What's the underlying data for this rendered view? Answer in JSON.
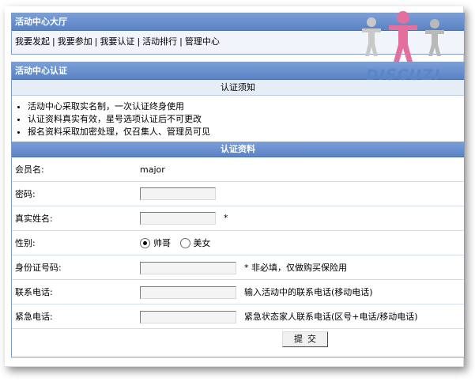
{
  "hall": {
    "title": "活动中心大厅",
    "nav": [
      "我要发起",
      "我要参加",
      "我要认证",
      "活动排行",
      "管理中心"
    ]
  },
  "cert": {
    "title": "活动中心认证",
    "notice_header": "认证须知",
    "notices": [
      "活动中心采取实名制，一次认证终身使用",
      "认证资料真实有效，星号选项认证后不可更改",
      "报名资料采取加密处理，仅召集人、管理员可见"
    ],
    "info_header": "认证资料",
    "fields": {
      "member_label": "会员名:",
      "member_value": "major",
      "password_label": "密码:",
      "realname_label": "真实姓名:",
      "realname_mark": "*",
      "gender_label": "性别:",
      "gender_male": "帅哥",
      "gender_female": "美女",
      "idcard_label": "身份证号码:",
      "idcard_hint": "*  非必填，仅做购买保险用",
      "phone_label": "联系电话:",
      "phone_hint": "输入活动中的联系电话(移动电话)",
      "emergency_label": "紧急电话:",
      "emergency_hint": "紧急状态家人联系电话(区号+电话/移动电话)"
    },
    "submit_label": "提交"
  },
  "logo": {
    "text": "DISCUZ!"
  },
  "colors": {
    "header_blue": "#5b82c4",
    "border_blue": "#7b9bc9",
    "logo_blue": "#5b86c6"
  }
}
